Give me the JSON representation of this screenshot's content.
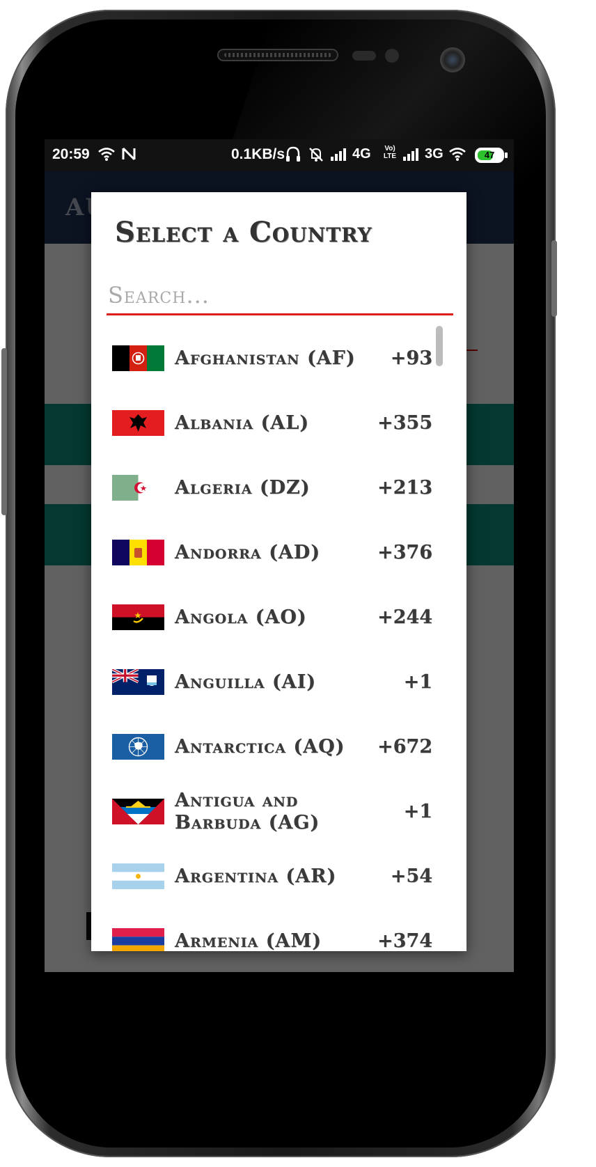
{
  "status_bar": {
    "time": "20:59",
    "network_speed": "0.1KB/s",
    "sim1_type": "4G",
    "sim1_volte": "Vo) LTE",
    "sim2_type": "3G",
    "battery": "47",
    "battery_color": "#2ec12e"
  },
  "app_bar": {
    "title": "AU"
  },
  "dialog": {
    "title": "Select a Country",
    "search_placeholder": "Search...",
    "accent_color": "#e01b1b",
    "countries": [
      {
        "name": "Afghanistan (AF)",
        "code": "+93",
        "flag": "afghanistan-flag"
      },
      {
        "name": "Albania (AL)",
        "code": "+355",
        "flag": "albania-flag"
      },
      {
        "name": "Algeria (DZ)",
        "code": "+213",
        "flag": "algeria-flag"
      },
      {
        "name": "Andorra (AD)",
        "code": "+376",
        "flag": "andorra-flag"
      },
      {
        "name": "Angola (AO)",
        "code": "+244",
        "flag": "angola-flag"
      },
      {
        "name": "Anguilla (AI)",
        "code": "+1",
        "flag": "anguilla-flag"
      },
      {
        "name": "Antarctica (AQ)",
        "code": "+672",
        "flag": "antarctica-flag"
      },
      {
        "name": "Antigua and Barbuda (AG)",
        "code": "+1",
        "flag": "antigua-barbuda-flag"
      },
      {
        "name": "Argentina (AR)",
        "code": "+54",
        "flag": "argentina-flag"
      },
      {
        "name": "Armenia (AM)",
        "code": "+374",
        "flag": "armenia-flag"
      }
    ]
  }
}
